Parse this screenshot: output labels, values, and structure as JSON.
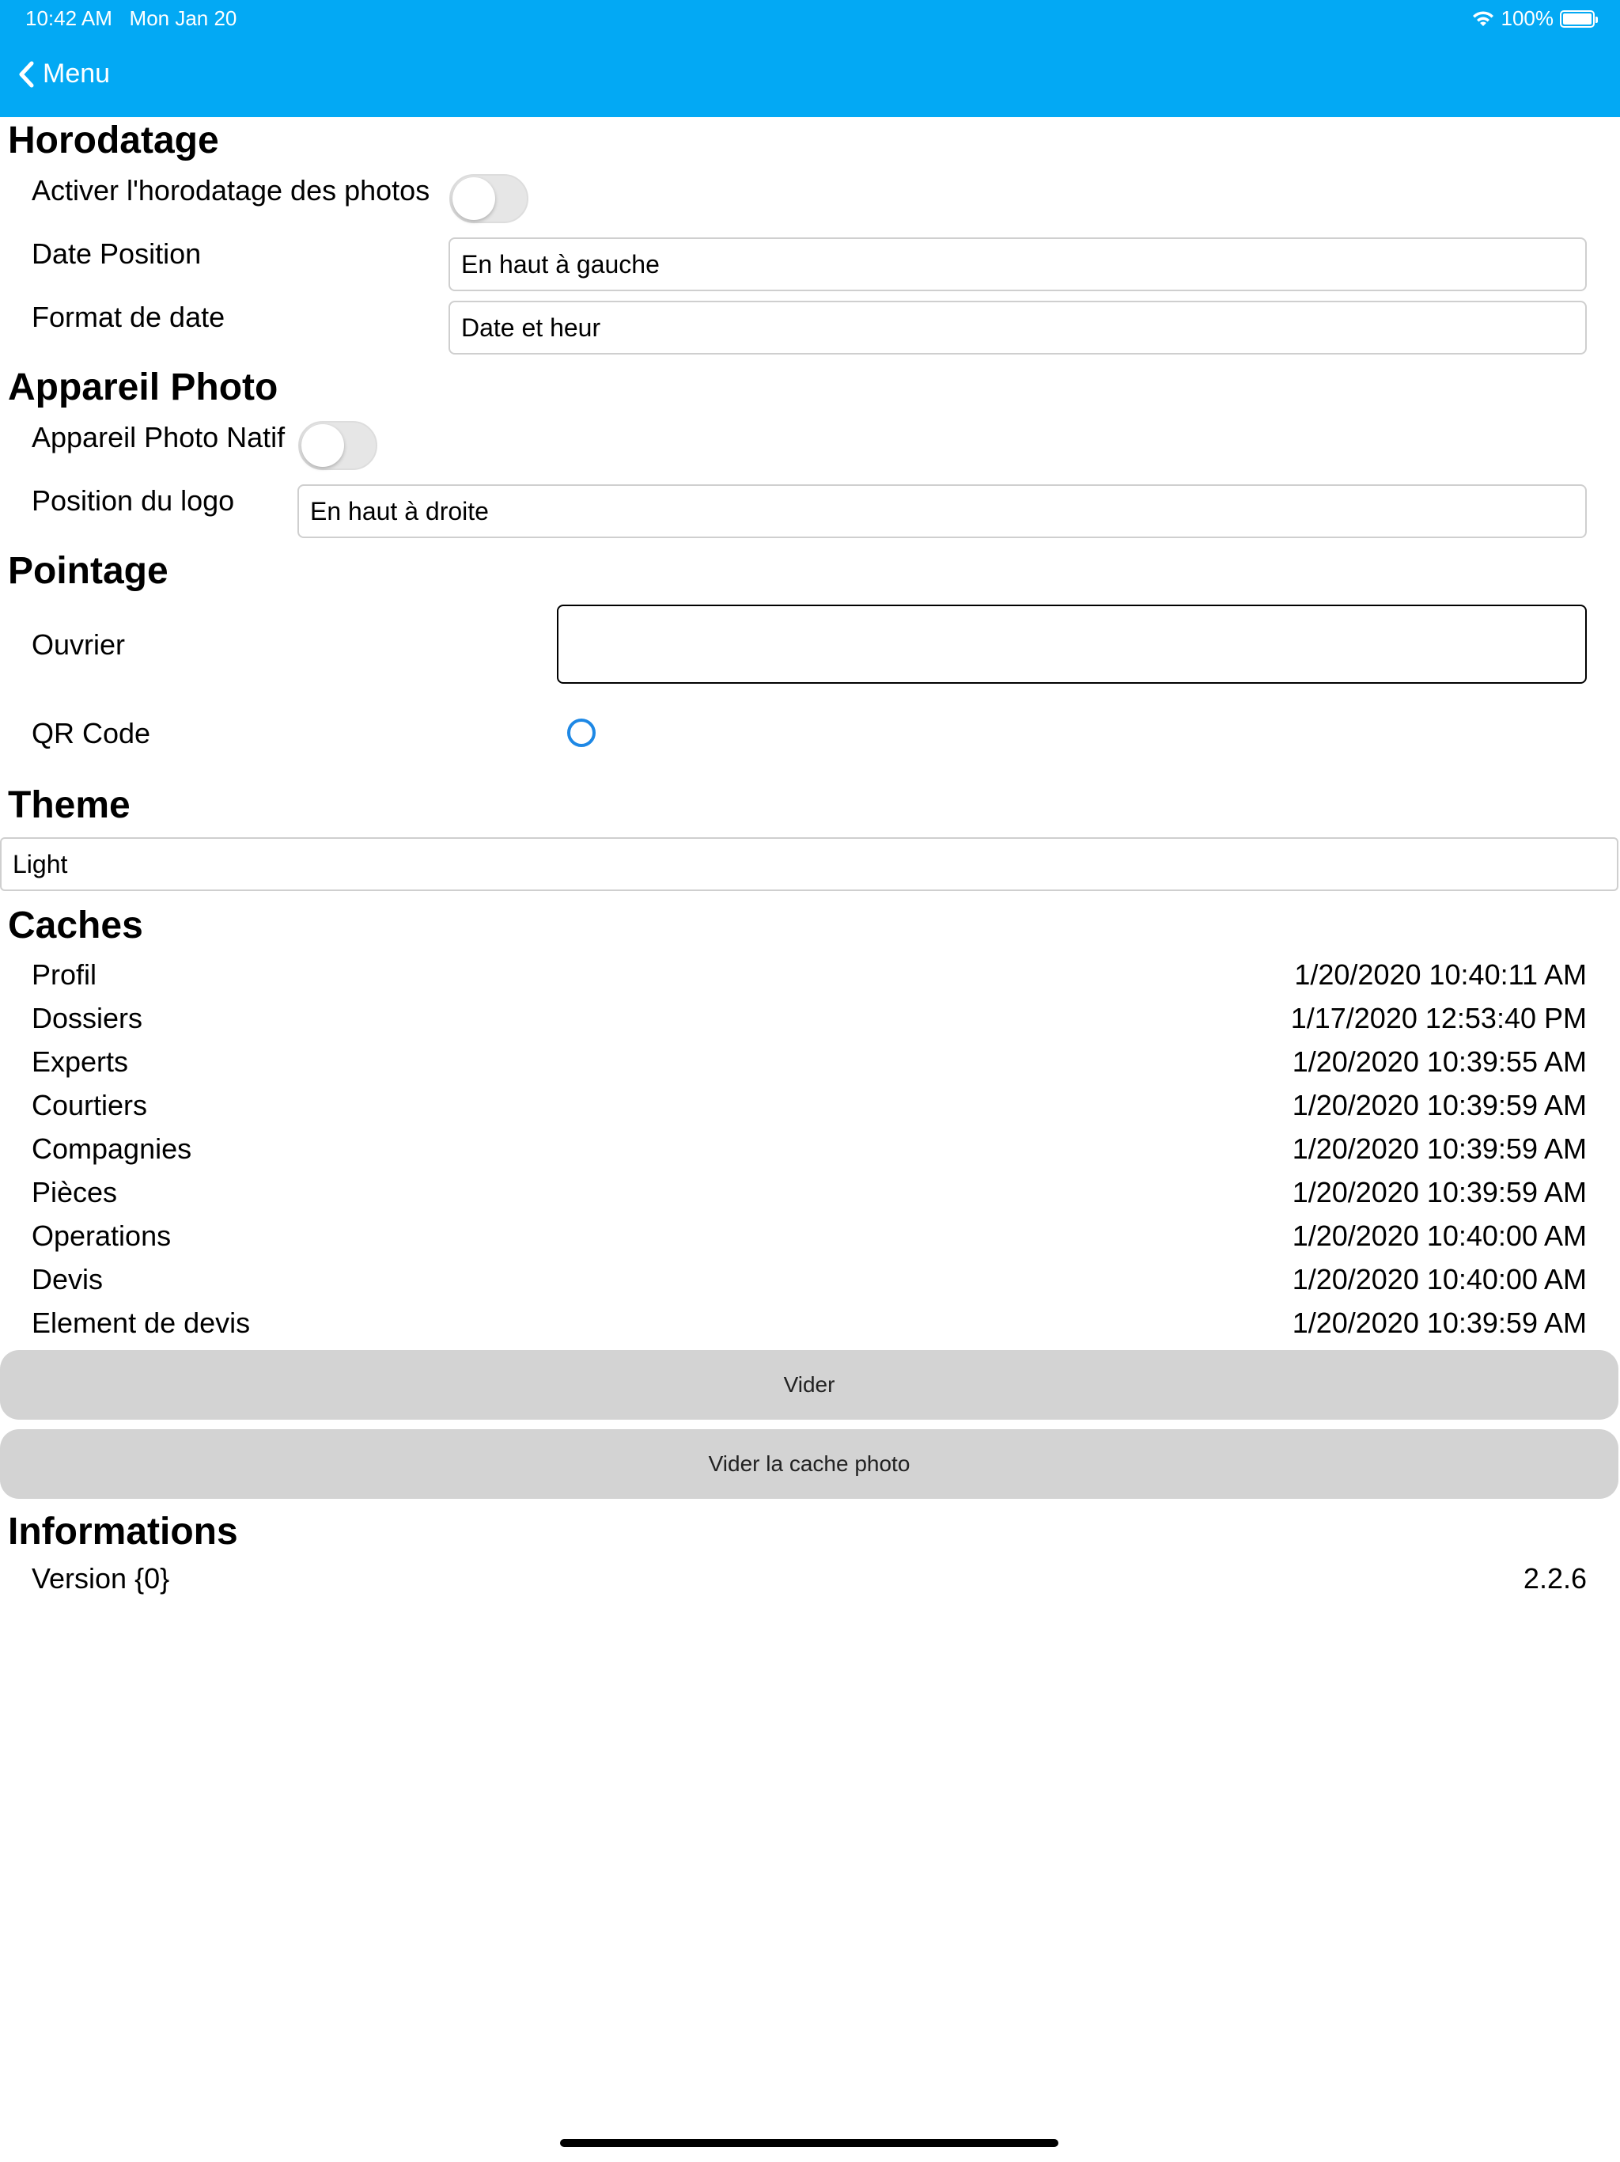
{
  "status": {
    "time": "10:42 AM",
    "date": "Mon Jan 20",
    "battery": "100%"
  },
  "nav": {
    "back_label": "Menu"
  },
  "horodatage": {
    "title": "Horodatage",
    "activate_label": "Activer l'horodatage des photos",
    "activate_on": false,
    "date_position_label": "Date Position",
    "date_position_value": "En haut à gauche",
    "date_format_label": "Format de date",
    "date_format_value": "Date et heur"
  },
  "camera": {
    "title": "Appareil Photo",
    "native_label": "Appareil Photo Natif",
    "native_on": false,
    "logo_position_label": "Position du logo",
    "logo_position_value": "En haut à droite"
  },
  "pointage": {
    "title": "Pointage",
    "worker_label": "Ouvrier",
    "worker_value": "",
    "qrcode_label": "QR Code"
  },
  "theme": {
    "title": "Theme",
    "value": "Light"
  },
  "caches": {
    "title": "Caches",
    "items": [
      {
        "name": "Profil",
        "date": "1/20/2020 10:40:11 AM"
      },
      {
        "name": "Dossiers",
        "date": "1/17/2020 12:53:40 PM"
      },
      {
        "name": "Experts",
        "date": "1/20/2020 10:39:55 AM"
      },
      {
        "name": "Courtiers",
        "date": "1/20/2020 10:39:59 AM"
      },
      {
        "name": "Compagnies",
        "date": "1/20/2020 10:39:59 AM"
      },
      {
        "name": "Pièces",
        "date": "1/20/2020 10:39:59 AM"
      },
      {
        "name": "Operations",
        "date": "1/20/2020 10:40:00 AM"
      },
      {
        "name": "Devis",
        "date": "1/20/2020 10:40:00 AM"
      },
      {
        "name": "Element de devis",
        "date": "1/20/2020 10:39:59 AM"
      }
    ],
    "clear_label": "Vider",
    "clear_photo_label": "Vider la cache photo"
  },
  "info": {
    "title": "Informations",
    "version_label": "Version {0}",
    "version_value": "2.2.6"
  },
  "colors": {
    "header": "#03A9F4",
    "radio": "#1E88E5",
    "button_bg": "#D3D3D3"
  }
}
